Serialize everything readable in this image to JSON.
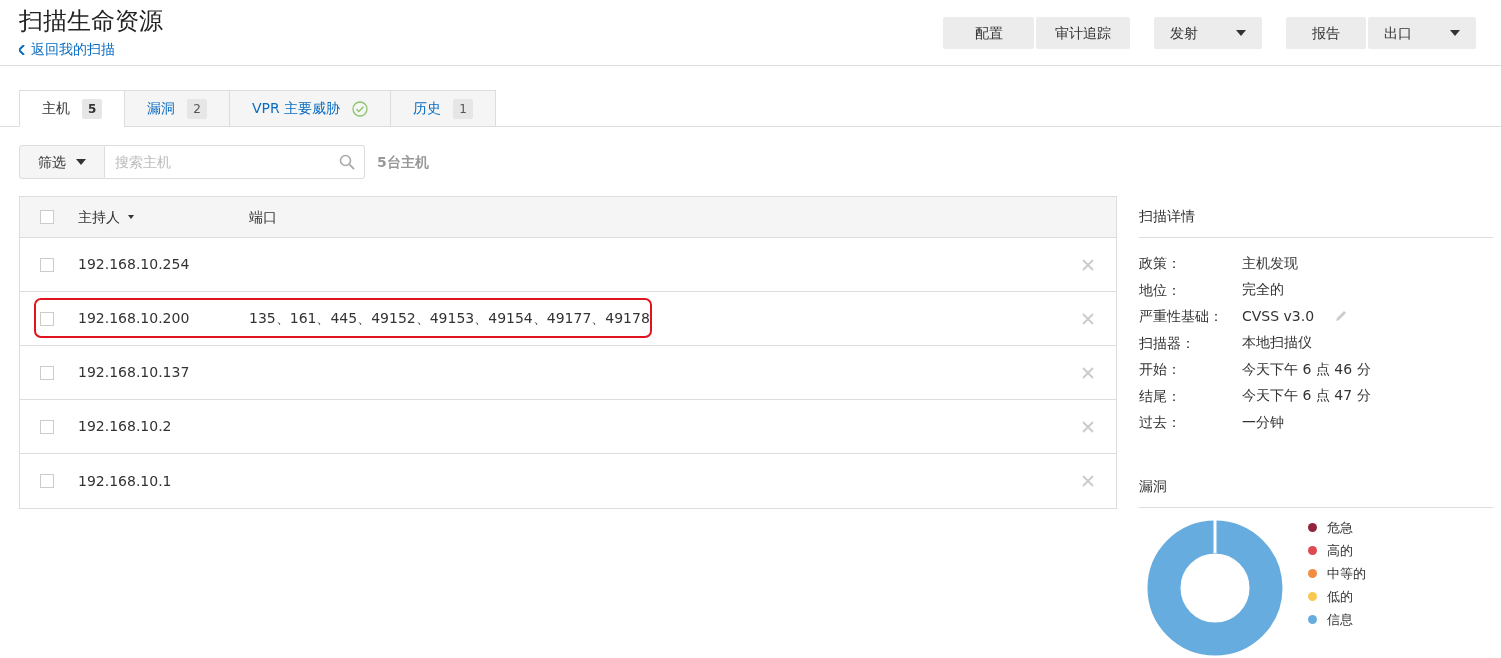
{
  "header": {
    "title": "扫描生命资源",
    "back_link": "返回我的扫描"
  },
  "toolbar": [
    {
      "kind": "group",
      "buttons": [
        {
          "label": "配置"
        },
        {
          "label": "审计追踪"
        }
      ]
    },
    {
      "kind": "dropdown",
      "buttons": [
        {
          "label": "发射"
        }
      ]
    },
    {
      "kind": "split",
      "buttons": [
        {
          "label": "报告"
        },
        {
          "label": "出口"
        }
      ]
    }
  ],
  "tabs": [
    {
      "label": "主机",
      "count": "5",
      "selected": true,
      "kind": "count"
    },
    {
      "label": "漏洞",
      "count": "2",
      "selected": false,
      "kind": "count"
    },
    {
      "label": "VPR 主要威胁",
      "selected": false,
      "kind": "check"
    },
    {
      "label": "历史",
      "count": "1",
      "selected": false,
      "kind": "count"
    }
  ],
  "filter": {
    "button": "筛选",
    "search_placeholder": "搜索主机",
    "host_count": "5台主机"
  },
  "table": {
    "columns": [
      "主持人",
      "端口"
    ],
    "all_checked": false,
    "rows": [
      {
        "host": "192.168.10.254",
        "ports": "",
        "checked": false,
        "highlighted": false
      },
      {
        "host": "192.168.10.200",
        "ports": "135、161、445、49152、49153、49154、49177、49178",
        "checked": false,
        "highlighted": true
      },
      {
        "host": "192.168.10.137",
        "ports": "",
        "checked": false,
        "highlighted": false
      },
      {
        "host": "192.168.10.2",
        "ports": "",
        "checked": false,
        "highlighted": false
      },
      {
        "host": "192.168.10.1",
        "ports": "",
        "checked": false,
        "highlighted": false
      }
    ]
  },
  "scan_details": {
    "title": "扫描详情",
    "fields": [
      {
        "label": "政策：",
        "value": "主机发现"
      },
      {
        "label": "地位：",
        "value": "完全的"
      },
      {
        "label": "严重性基础：",
        "value": "CVSS v3.0",
        "editable": true
      },
      {
        "label": "扫描器：",
        "value": "本地扫描仪"
      },
      {
        "label": "开始：",
        "value": "今天下午 6 点 46 分"
      },
      {
        "label": "结尾：",
        "value": "今天下午 6 点 47 分"
      },
      {
        "label": "过去：",
        "value": "一分钟"
      }
    ]
  },
  "vulnerabilities": {
    "title": "漏洞",
    "legend": [
      {
        "label": "危急",
        "color": "#91243e"
      },
      {
        "label": "高的",
        "color": "#dd4b50"
      },
      {
        "label": "中等的",
        "color": "#f18c43"
      },
      {
        "label": "低的",
        "color": "#f8c851"
      },
      {
        "label": "信息",
        "color": "#67acdf"
      }
    ]
  }
}
